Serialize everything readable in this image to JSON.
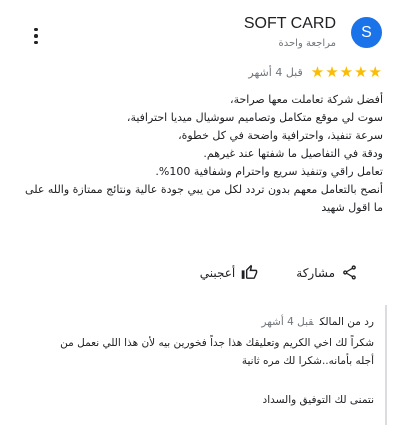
{
  "author": {
    "initial": "S",
    "avatar_color": "#1a73e8",
    "name": "SOFT CARD",
    "subtitle": "مراجعة واحدة"
  },
  "menu_icon": "more-vert-icon",
  "rating": {
    "stars": 5,
    "max": 5,
    "star_color": "#fbbc04",
    "time": "قبل 4 أشهر"
  },
  "review_lines": [
    "أفضل شركة تعاملت معها صراحة،",
    "سوت لي موقع متكامل وتصاميم سوشيال ميديا احترافية،",
    "سرعة تنفيذ، واحترافية واضحة في كل خطوة،",
    "ودقة في التفاصيل ما شفتها عند غيرهم.",
    "تعامل راقي وتنفيذ سريع واحترام وشفافية 100%.",
    "أنصح بالتعامل معهم بدون تردد لكل من يبي جودة عالية ونتائج ممتازة والله على ما اقول شهيد"
  ],
  "actions": {
    "like_label": "أعجبني",
    "like_icon": "thumb-up-icon",
    "share_label": "مشاركة",
    "share_icon": "share-icon"
  },
  "owner_reply": {
    "label": "رد من المالك",
    "time": "قبل 4 أشهر",
    "lines": [
      "شكراً لك اخي الكريم وتعليقك هذا جداً فخورين بيه لأن هذا اللي نعمل من",
      "أجله بأمانه..شكرا لك مره ثانية",
      "",
      "نتمنى لك التوفيق والسداد"
    ]
  }
}
